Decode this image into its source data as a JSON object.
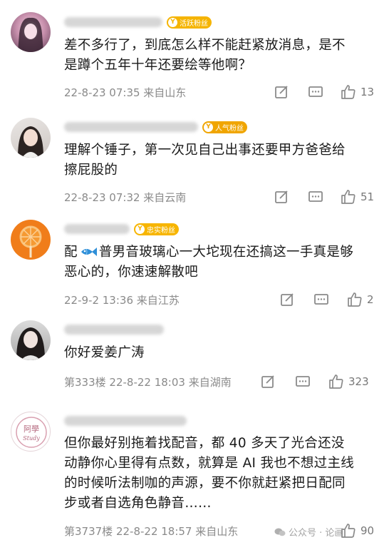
{
  "comments": [
    {
      "badge": "活跃粉丝",
      "text": "差不多行了，到底怎么样不能赶紧放消息，是不\n是蹲个五年十年还要绘等他啊？",
      "meta": "22-8-23 07:35  来自山东",
      "likes": "13"
    },
    {
      "badge": "人气粉丝",
      "text": "理解个锤子，第一次见自己出事还要甲方爸爸给\n擦屁股的",
      "meta": "22-8-23 07:32  来自云南",
      "likes": "51"
    },
    {
      "badge": "忠实粉丝",
      "text_before": "配",
      "text_after": "普男音玻璃心一大坨现在还搞这一手真是够\n恶心的，你速速解散吧",
      "meta": "22-9-2 13:36  来自江苏",
      "likes": "2"
    },
    {
      "text": "你好爱姜广涛",
      "meta": "第333楼  22-8-22 18:03  来自湖南",
      "likes": "323"
    },
    {
      "avatar_text_top": "阿學",
      "avatar_text_bottom": "Study",
      "text": "但你最好别拖着找配音，都 40 多天了光合还没\n动静你心里得有点数，就算是 AI 我也不想过主线\n的时候听法制咖的声源，要不你就赶紧把日配同\n步或者自选角色静音……",
      "meta": "第3737楼  22-8-22 18:57  来自山东",
      "likes": "90"
    }
  ],
  "watermark": "公众号 · 论画",
  "colors": {
    "badge_active": "#f5b400",
    "badge_popular": "#f0a500",
    "badge_loyal": "#f7b500",
    "meta": "#8a8a8a",
    "icon": "#8a8a8a"
  }
}
